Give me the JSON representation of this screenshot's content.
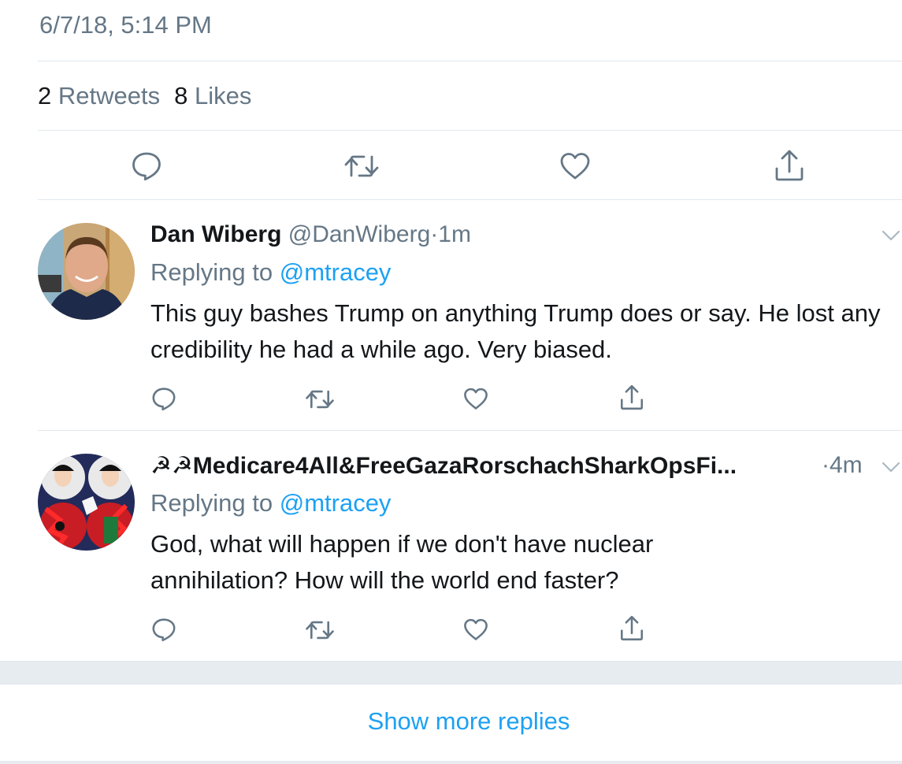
{
  "tweet": {
    "timestamp": "6/7/18, 5:14 PM",
    "retweets_count": "2",
    "retweets_label": "Retweets",
    "likes_count": "8",
    "likes_label": "Likes"
  },
  "action_icons": [
    "reply-icon",
    "retweet-icon",
    "like-icon",
    "share-icon"
  ],
  "replies": [
    {
      "name": "Dan Wiberg",
      "handle": "@DanWiberg",
      "separator": "·",
      "time": "1m",
      "replying_prefix": "Replying to",
      "replying_to": "@mtracey",
      "text": "This guy bashes Trump on anything Trump does or say. He lost any credibility he had a while ago. Very biased."
    },
    {
      "name": "☭☭Medicare4All&FreeGazaRorschachSharkOpsFi...",
      "separator": "·",
      "time": "4m",
      "replying_prefix": "Replying to",
      "replying_to": "@mtracey",
      "text": "God, what will happen if we don't have nuclear annihilation? How will the world end faster?"
    }
  ],
  "show_more_label": "Show more replies",
  "colors": {
    "accent": "#1da1f2",
    "secondary_text": "#657786",
    "divider": "#e1e8ed",
    "band": "#e6ecf0"
  }
}
